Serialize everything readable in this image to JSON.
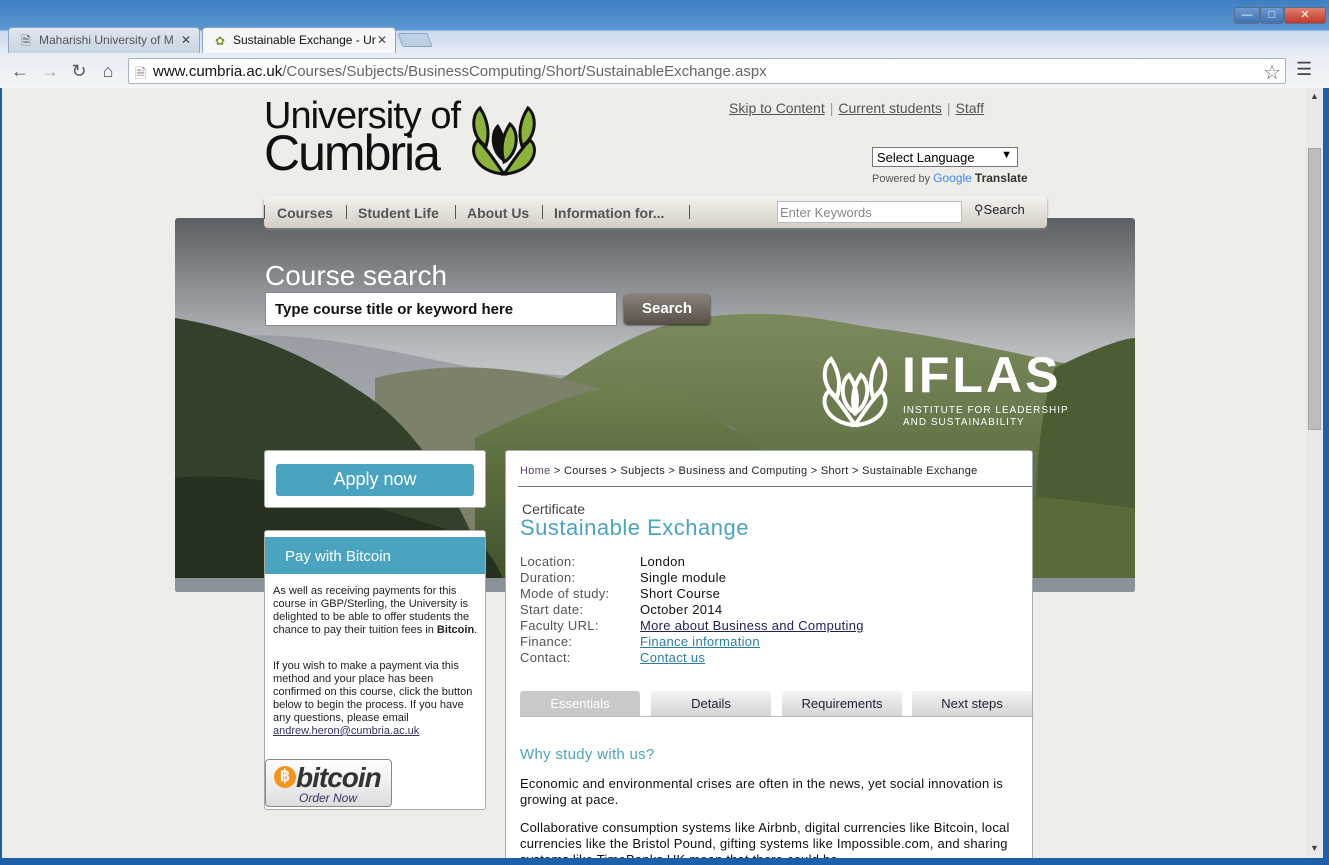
{
  "browser": {
    "tabs": [
      {
        "title": "Maharishi University of M",
        "active": false
      },
      {
        "title": "Sustainable Exchange - Ur",
        "active": true
      }
    ],
    "url_host": "www.cumbria.ac.uk",
    "url_path": "/Courses/Subjects/BusinessComputing/Short/SustainableExchange.aspx"
  },
  "header": {
    "logo_line1": "University of",
    "logo_line2": "Cumbria",
    "top_links": [
      "Skip to Content",
      "Current students",
      "Staff"
    ],
    "language_select": "Select Language",
    "powered_by": "Powered by",
    "google": "Google",
    "translate": "Translate"
  },
  "main_nav": {
    "items": [
      "Courses",
      "Student Life",
      "About Us",
      "Information for..."
    ],
    "keyword_placeholder": "Enter Keywords",
    "search_label": "Search"
  },
  "hero": {
    "title": "Course search",
    "input_value": "Type course title or keyword here",
    "search_button": "Search",
    "brand": "IFLAS",
    "brand_sub": "INSTITUTE FOR LEADERSHIP AND SUSTAINABILITY"
  },
  "sidebar": {
    "apply_label": "Apply now",
    "bitcoin_heading": "Pay with Bitcoin",
    "para1_pre": "As well as receiving payments for this course in GBP/Sterling, the University is delighted to be able to offer students the chance to pay their tuition fees in ",
    "para1_bold": "Bitcoin",
    "para1_post": ".",
    "para2": "If you wish to make a payment via this method and your place has been confirmed on this course, click the button below to begin the process. If you have any questions, please email",
    "email": "andrew.heron@cumbria.ac.uk",
    "badge_word": "bitcoin",
    "badge_order": "Order Now"
  },
  "content": {
    "breadcrumbs": [
      "Home",
      "Courses",
      "Subjects",
      "Business and Computing",
      "Short",
      "Sustainable Exchange"
    ],
    "breadcrumb_sep": " > ",
    "award": "Certificate",
    "title": "Sustainable Exchange",
    "meta": [
      {
        "label": "Location:",
        "value": "London"
      },
      {
        "label": "Duration:",
        "value": "Single module"
      },
      {
        "label": "Mode of study:",
        "value": "Short Course"
      },
      {
        "label": "Start date:",
        "value": "October 2014"
      },
      {
        "label": "Faculty URL:",
        "value": "More about Business and Computing"
      },
      {
        "label": "Finance:",
        "value": "Finance information"
      },
      {
        "label": "Contact:",
        "value": "Contact us"
      }
    ],
    "tabs": [
      "Essentials",
      "Details",
      "Requirements",
      "Next steps"
    ],
    "active_tab": "Essentials",
    "why_heading": "Why study with us?",
    "para1": "Economic and environmental crises are often in the news, yet social innovation is growing at pace.",
    "para2": "Collaborative consumption systems like Airbnb, digital currencies like Bitcoin, local currencies like the Bristol Pound, gifting systems like Impossible.com, and sharing systems like TimeBanks UK mean that there could be..."
  },
  "colors": {
    "accent": "#4aa4bf",
    "page_bg": "#eeede9",
    "bitcoin_orange": "#f7931a"
  }
}
